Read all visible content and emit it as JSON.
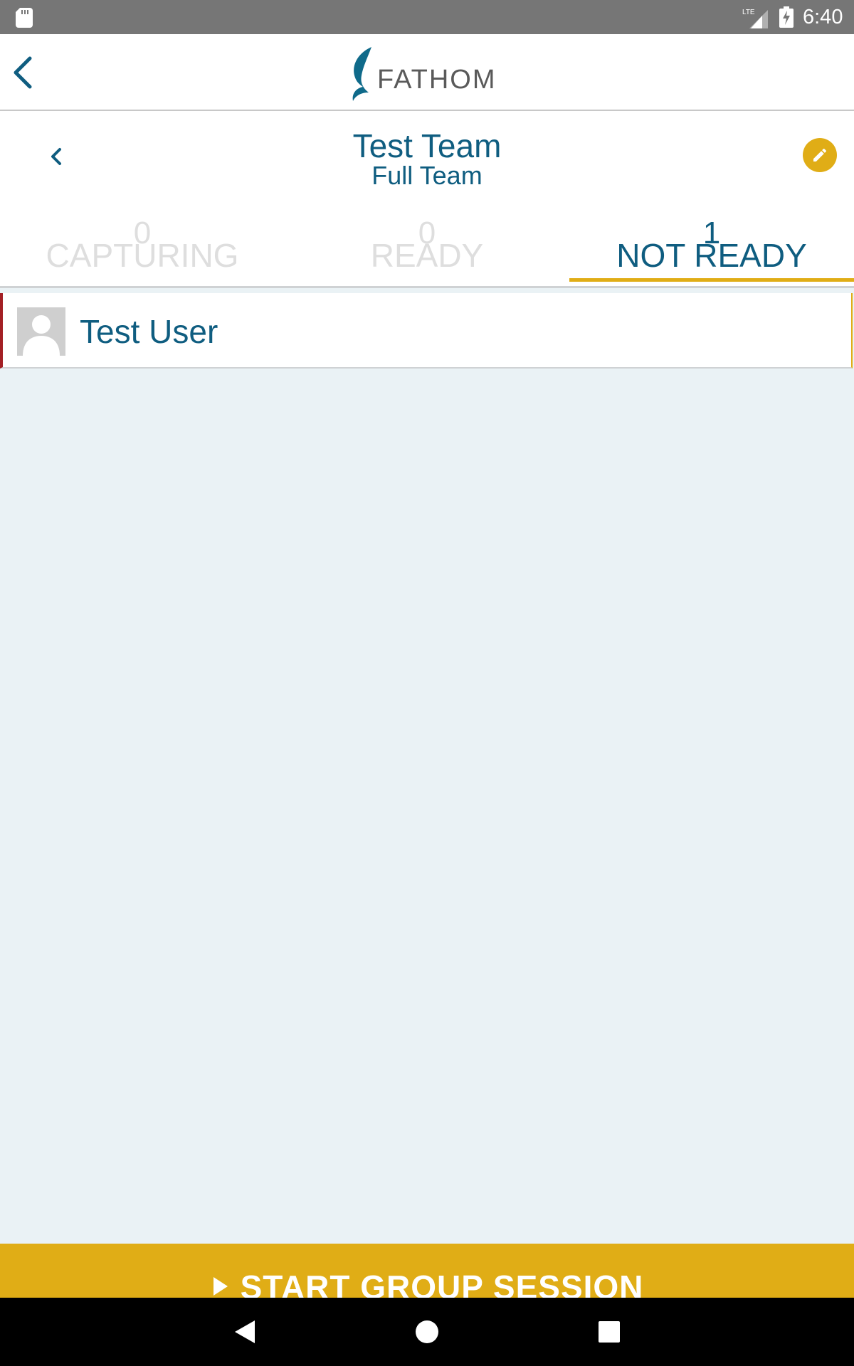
{
  "status_bar": {
    "time": "6:40",
    "network_label": "LTE",
    "icons": [
      "sd-card-icon",
      "signal-icon",
      "battery-charging-icon"
    ]
  },
  "header": {
    "logo_text": "FATHOM",
    "icons": [
      "back-arrow-icon",
      "fathom-logo-icon"
    ]
  },
  "team": {
    "name": "Test Team",
    "subtitle": "Full Team",
    "icons": [
      "chevron-left-icon",
      "pencil-icon"
    ]
  },
  "tabs": [
    {
      "count": "0",
      "label": "CAPTURING",
      "active": false
    },
    {
      "count": "0",
      "label": "READY",
      "active": false
    },
    {
      "count": "1",
      "label": "NOT READY",
      "active": true
    }
  ],
  "members": [
    {
      "name": "Test User",
      "icon": "avatar-placeholder-icon"
    }
  ],
  "cta": {
    "label": "START GROUP SESSION",
    "icon": "play-icon"
  },
  "nav_bar": {
    "icons": [
      "nav-back-icon",
      "nav-home-icon",
      "nav-recents-icon"
    ]
  },
  "colors": {
    "primary": "#0f5d80",
    "accent": "#e0ad16",
    "not_ready_marker": "#a31f24",
    "background": "#eaf2f5",
    "status_bar": "#767676"
  }
}
